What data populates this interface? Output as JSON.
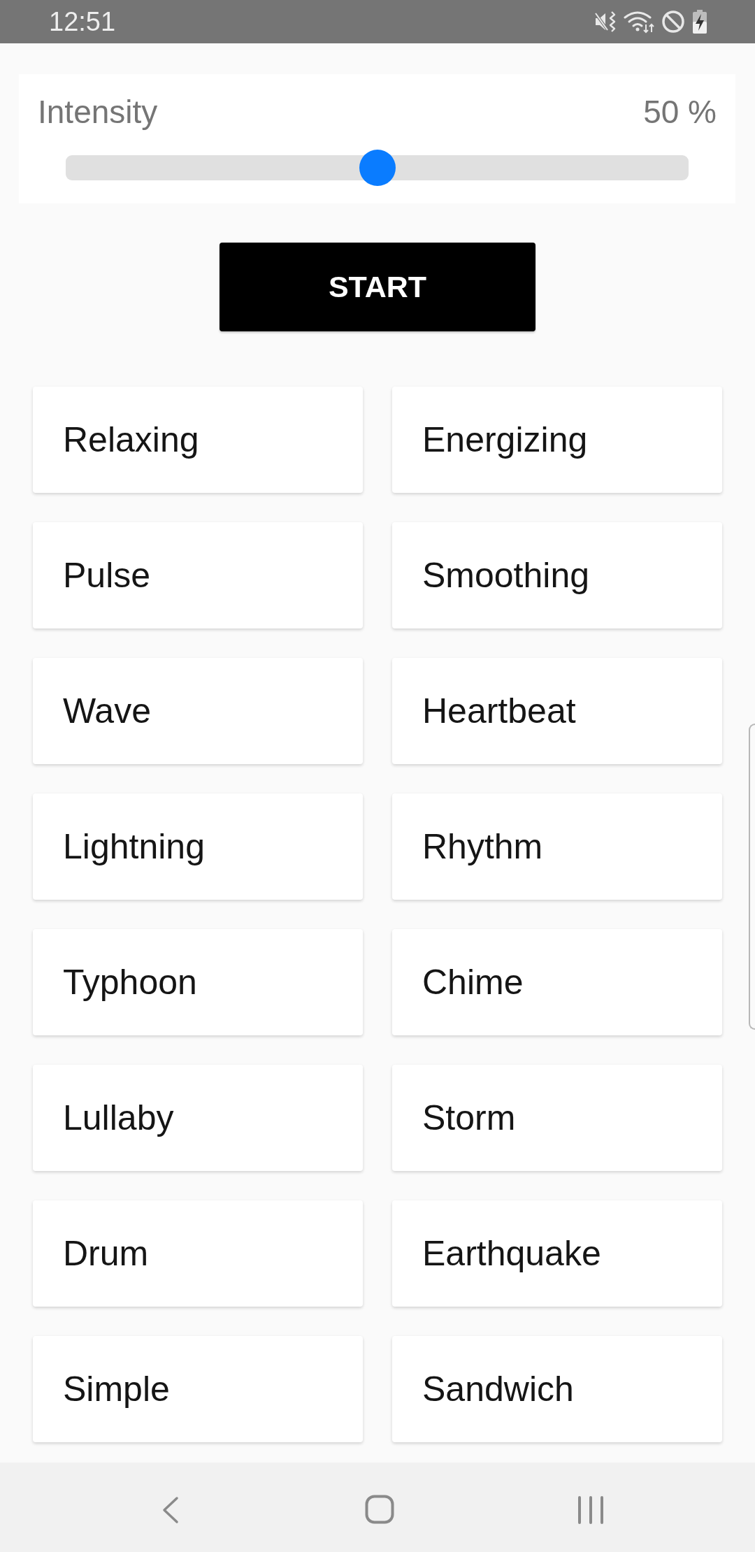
{
  "status_bar": {
    "time": "12:51"
  },
  "intensity": {
    "label": "Intensity",
    "reading": "50 %",
    "level": 0.5
  },
  "start_button": {
    "label": "START"
  },
  "patterns": [
    {
      "label": "Relaxing"
    },
    {
      "label": "Energizing"
    },
    {
      "label": "Pulse"
    },
    {
      "label": "Smoothing"
    },
    {
      "label": "Wave"
    },
    {
      "label": "Heartbeat"
    },
    {
      "label": "Lightning"
    },
    {
      "label": "Rhythm"
    },
    {
      "label": "Typhoon"
    },
    {
      "label": "Chime"
    },
    {
      "label": "Lullaby"
    },
    {
      "label": "Storm"
    },
    {
      "label": "Drum"
    },
    {
      "label": "Earthquake"
    },
    {
      "label": "Simple"
    },
    {
      "label": "Sandwich"
    }
  ]
}
